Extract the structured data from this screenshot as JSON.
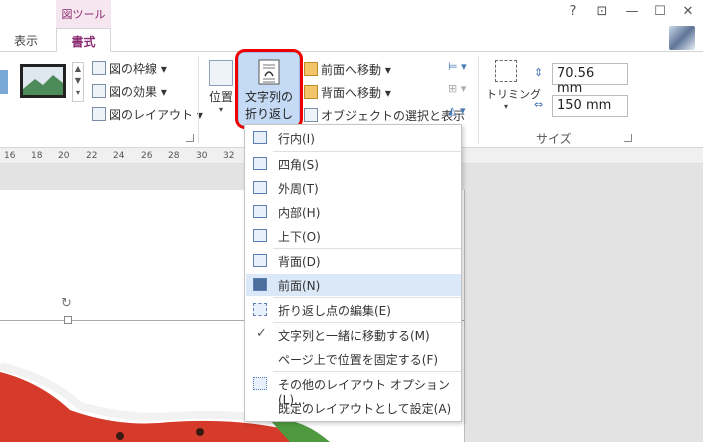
{
  "titlebar": {
    "context_tab": "図ツール",
    "help": "?",
    "ribbon_display": "⊡",
    "minimize": "—",
    "maximize": "☐",
    "close": "✕"
  },
  "tabs": [
    {
      "label": "表示"
    },
    {
      "label": "書式"
    }
  ],
  "ribbon": {
    "picture_border": "図の枠線",
    "picture_effects": "図の効果",
    "picture_layout": "図のレイアウト",
    "position": "位置",
    "wrap_text_line1": "文字列の",
    "wrap_text_line2": "折り返し",
    "bring_forward": "前面へ移動",
    "send_backward": "背面へ移動",
    "selection_pane": "オブジェクトの選択と表示",
    "crop": "トリミング",
    "height_value": "70.56 mm",
    "width_value": "150 mm",
    "size_group": "サイズ"
  },
  "ruler": [
    "16",
    "18",
    "20",
    "22",
    "24",
    "26",
    "28",
    "30",
    "32"
  ],
  "wrap_menu": {
    "items": [
      {
        "label": "行内(I)"
      },
      {
        "label": "四角(S)"
      },
      {
        "label": "外周(T)"
      },
      {
        "label": "内部(H)"
      },
      {
        "label": "上下(O)"
      },
      {
        "label": "背面(D)"
      },
      {
        "label": "前面(N)"
      },
      {
        "label": "折り返し点の編集(E)"
      },
      {
        "label": "文字列と一緒に移動する(M)"
      },
      {
        "label": "ページ上で位置を固定する(F)"
      },
      {
        "label": "その他のレイアウト オプション(L)..."
      },
      {
        "label": "既定のレイアウトとして設定(A)"
      }
    ]
  },
  "colors": {
    "accent": "#8b2b73",
    "highlight_ring": "#ee0000",
    "wrap_button_bg": "#c5daf4"
  }
}
